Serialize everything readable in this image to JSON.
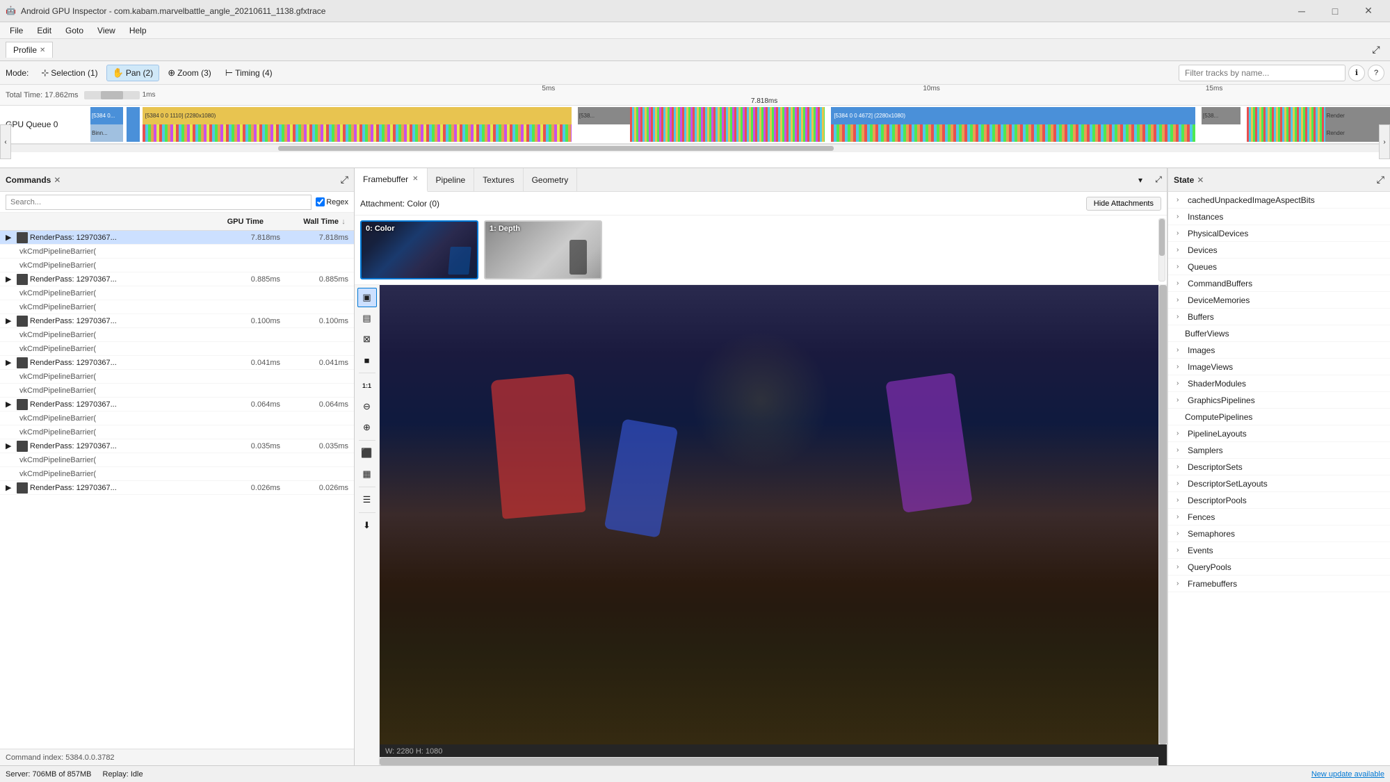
{
  "titlebar": {
    "icon": "🤖",
    "title": "Android GPU Inspector - com.kabam.marvelbattle_angle_20210611_1138.gfxtrace",
    "minimize": "─",
    "maximize": "□",
    "close": "✕"
  },
  "menubar": {
    "items": [
      "File",
      "Edit",
      "Goto",
      "View",
      "Help"
    ]
  },
  "profile_tab": {
    "label": "Profile",
    "close": "✕",
    "expand": "⤢"
  },
  "mode_bar": {
    "modes": [
      {
        "label": "Selection (1)",
        "icon": "⊹",
        "active": false
      },
      {
        "label": "Pan (2)",
        "icon": "✋",
        "active": true
      },
      {
        "label": "Zoom (3)",
        "icon": "⊕",
        "active": false
      },
      {
        "label": "Timing (4)",
        "icon": "⊢",
        "active": false
      }
    ],
    "filter_placeholder": "Filter tracks by name...",
    "info_icon": "ℹ",
    "help_icon": "?"
  },
  "timeline": {
    "total_time": "Total Time: 17.862ms",
    "slider_time": "1ms",
    "tick_5ms": "5ms",
    "tick_10ms": "10ms",
    "tick_15ms": "15ms",
    "indicator": "7.818ms",
    "gpu_queue_label": "GPU Queue 0"
  },
  "commands_pane": {
    "title": "Commands",
    "close": "✕",
    "expand": "⤢",
    "search_placeholder": "Search...",
    "regex_label": "Regex",
    "col_gpu_time": "GPU Time",
    "col_wall_time": "Wall Time",
    "rows": [
      {
        "type": "parent",
        "name": "RenderPass: 12970367...",
        "gpu": "7.818ms",
        "wall": "7.818ms",
        "selected": true
      },
      {
        "type": "child",
        "name": "vkCmdPipelineBarrier(",
        "gpu": "",
        "wall": ""
      },
      {
        "type": "child",
        "name": "vkCmdPipelineBarrier(",
        "gpu": "",
        "wall": ""
      },
      {
        "type": "parent",
        "name": "RenderPass: 12970367...",
        "gpu": "0.885ms",
        "wall": "0.885ms"
      },
      {
        "type": "child",
        "name": "vkCmdPipelineBarrier(",
        "gpu": "",
        "wall": ""
      },
      {
        "type": "child",
        "name": "vkCmdPipelineBarrier(",
        "gpu": "",
        "wall": ""
      },
      {
        "type": "parent",
        "name": "RenderPass: 12970367...",
        "gpu": "0.100ms",
        "wall": "0.100ms"
      },
      {
        "type": "child",
        "name": "vkCmdPipelineBarrier(",
        "gpu": "",
        "wall": ""
      },
      {
        "type": "child",
        "name": "vkCmdPipelineBarrier(",
        "gpu": "",
        "wall": ""
      },
      {
        "type": "parent",
        "name": "RenderPass: 12970367...",
        "gpu": "0.041ms",
        "wall": "0.041ms"
      },
      {
        "type": "child",
        "name": "vkCmdPipelineBarrier(",
        "gpu": "",
        "wall": ""
      },
      {
        "type": "child",
        "name": "vkCmdPipelineBarrier(",
        "gpu": "",
        "wall": ""
      },
      {
        "type": "parent",
        "name": "RenderPass: 12970367...",
        "gpu": "0.064ms",
        "wall": "0.064ms"
      },
      {
        "type": "child",
        "name": "vkCmdPipelineBarrier(",
        "gpu": "",
        "wall": ""
      },
      {
        "type": "child",
        "name": "vkCmdPipelineBarrier(",
        "gpu": "",
        "wall": ""
      },
      {
        "type": "parent",
        "name": "RenderPass: 12970367...",
        "gpu": "0.035ms",
        "wall": "0.035ms"
      },
      {
        "type": "child",
        "name": "vkCmdPipelineBarrier(",
        "gpu": "",
        "wall": ""
      },
      {
        "type": "child",
        "name": "vkCmdPipelineBarrier(",
        "gpu": "",
        "wall": ""
      },
      {
        "type": "parent",
        "name": "RenderPass: 12970367...",
        "gpu": "0.026ms",
        "wall": "0.026ms"
      }
    ],
    "command_index": "Command index: 5384.0.0.3782"
  },
  "framebuffer_pane": {
    "tabs": [
      "Framebuffer",
      "Pipeline",
      "Textures",
      "Geometry"
    ],
    "active_tab": "Framebuffer",
    "attachment_label": "Attachment: Color (0)",
    "hide_btn": "Hide Attachments",
    "thumbnails": [
      {
        "label": "0: Color",
        "type": "color"
      },
      {
        "label": "1: Depth",
        "type": "depth"
      }
    ],
    "size_label": "W: 2280 H: 1080",
    "tools": [
      "▣",
      "▤",
      "⊠",
      "■",
      "⬚",
      "1:1",
      "⊖",
      "⊕",
      "⬛",
      "▦",
      "☰",
      "⬇"
    ]
  },
  "state_pane": {
    "title": "State",
    "close": "✕",
    "expand": "⤢",
    "items": [
      {
        "label": "cachedUnpackedImageAspectBits",
        "indent": false
      },
      {
        "label": "Instances",
        "indent": false
      },
      {
        "label": "PhysicalDevices",
        "indent": false
      },
      {
        "label": "Devices",
        "indent": false
      },
      {
        "label": "Queues",
        "indent": false
      },
      {
        "label": "CommandBuffers",
        "indent": false
      },
      {
        "label": "DeviceMemories",
        "indent": false
      },
      {
        "label": "Buffers",
        "indent": false
      },
      {
        "label": "BufferViews",
        "indent": true
      },
      {
        "label": "Images",
        "indent": false
      },
      {
        "label": "ImageViews",
        "indent": false
      },
      {
        "label": "ShaderModules",
        "indent": false
      },
      {
        "label": "GraphicsPipelines",
        "indent": false
      },
      {
        "label": "ComputePipelines",
        "indent": true
      },
      {
        "label": "PipelineLayouts",
        "indent": false
      },
      {
        "label": "Samplers",
        "indent": false
      },
      {
        "label": "DescriptorSets",
        "indent": false
      },
      {
        "label": "DescriptorSetLayouts",
        "indent": false
      },
      {
        "label": "DescriptorPools",
        "indent": false
      },
      {
        "label": "Fences",
        "indent": false
      },
      {
        "label": "Semaphores",
        "indent": false
      },
      {
        "label": "Events",
        "indent": false
      },
      {
        "label": "QueryPools",
        "indent": false
      },
      {
        "label": "Framebuffers",
        "indent": false
      }
    ]
  },
  "status_bar": {
    "server": "Server: 706MB of 857MB",
    "replay": "Replay: Idle",
    "update": "New update available"
  }
}
